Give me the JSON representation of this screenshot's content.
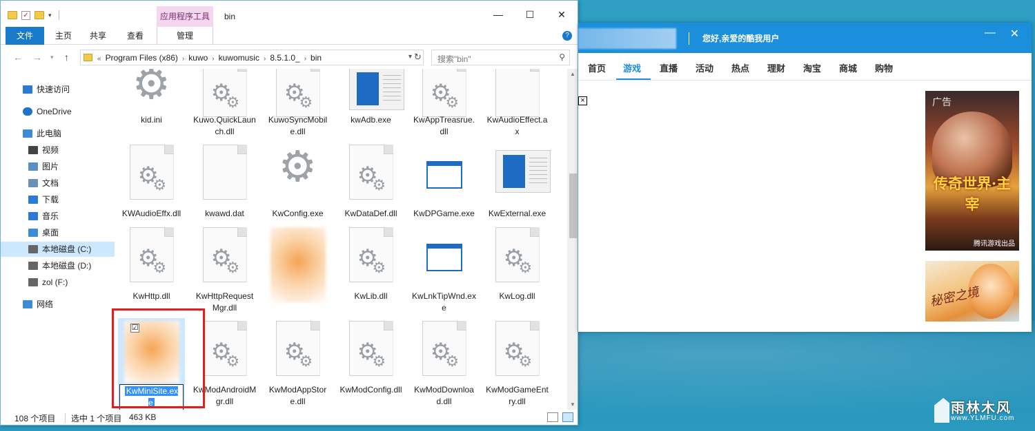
{
  "explorer": {
    "context_tab": "应用程序工具",
    "title": "bin",
    "win_controls": {
      "minimize": "—",
      "maximize": "☐",
      "close": "✕"
    },
    "ribbon": {
      "file": "文件",
      "home": "主页",
      "share": "共享",
      "view": "查看",
      "manage": "管理",
      "help": "?"
    },
    "address": {
      "crumbs": [
        "Program Files (x86)",
        "kuwo",
        "kuwomusic",
        "8.5.1.0_",
        "bin"
      ],
      "search_placeholder": "搜索\"bin\""
    },
    "nav": [
      {
        "label": "快速访问",
        "icon": "star-icon"
      },
      {
        "label": "OneDrive",
        "icon": "cloud-icon"
      },
      {
        "label": "此电脑",
        "icon": "computer-icon"
      },
      {
        "label": "视频",
        "icon": "video-icon"
      },
      {
        "label": "图片",
        "icon": "picture-icon"
      },
      {
        "label": "文档",
        "icon": "document-icon"
      },
      {
        "label": "下载",
        "icon": "download-icon"
      },
      {
        "label": "音乐",
        "icon": "music-icon"
      },
      {
        "label": "桌面",
        "icon": "desktop-icon"
      },
      {
        "label": "本地磁盘 (C:)",
        "icon": "drive-icon"
      },
      {
        "label": "本地磁盘 (D:)",
        "icon": "drive-icon"
      },
      {
        "label": "zol (F:)",
        "icon": "drive-icon"
      },
      {
        "label": "网络",
        "icon": "network-icon"
      }
    ],
    "files": [
      {
        "name": "kid.ini",
        "icon": "settings-gear-icon"
      },
      {
        "name": "Kuwo.QuickLaunch.dll",
        "icon": "dll-file-icon"
      },
      {
        "name": "KuwoSyncMobile.dll",
        "icon": "dll-file-icon"
      },
      {
        "name": "kwAdb.exe",
        "icon": "app-window-icon"
      },
      {
        "name": "KwAppTreasrue.dll",
        "icon": "dll-file-icon"
      },
      {
        "name": "KwAudioEffect.ax",
        "icon": "blank-file-icon"
      },
      {
        "name": "KWAudioEffx.dll",
        "icon": "dll-file-icon"
      },
      {
        "name": "kwawd.dat",
        "icon": "blank-file-icon"
      },
      {
        "name": "KwConfig.exe",
        "icon": "settings-gear-icon"
      },
      {
        "name": "KwDataDef.dll",
        "icon": "dll-file-icon"
      },
      {
        "name": "KwDPGame.exe",
        "icon": "exe-window-icon"
      },
      {
        "name": "KwExternal.exe",
        "icon": "app-window-icon"
      },
      {
        "name": "KwHttp.dll",
        "icon": "dll-file-icon"
      },
      {
        "name": "KwHttpRequestMgr.dll",
        "icon": "dll-file-icon"
      },
      {
        "name": "",
        "icon": "blurred-icon"
      },
      {
        "name": "KwLib.dll",
        "icon": "dll-file-icon"
      },
      {
        "name": "KwLnkTipWnd.exe",
        "icon": "exe-window-icon"
      },
      {
        "name": "KwLog.dll",
        "icon": "dll-file-icon"
      },
      {
        "name": "KwMiniSite.exe",
        "icon": "blurred-icon"
      },
      {
        "name": "KwModAndroidMgr.dll",
        "icon": "dll-file-icon"
      },
      {
        "name": "KwModAppStore.dll",
        "icon": "dll-file-icon"
      },
      {
        "name": "KwModConfig.dll",
        "icon": "dll-file-icon"
      },
      {
        "name": "KwModDownload.dll",
        "icon": "dll-file-icon"
      },
      {
        "name": "KwModGameEntry.dll",
        "icon": "dll-file-icon"
      }
    ],
    "selection_checkbox": "☑",
    "status": {
      "count": "108 个项目",
      "selected": "选中 1 个项目",
      "size": "463 KB"
    }
  },
  "kuwo": {
    "greeting": "您好,亲爱的酷我用户",
    "nav": [
      "首页",
      "游戏",
      "直播",
      "活动",
      "热点",
      "理财",
      "淘宝",
      "商城",
      "购物"
    ],
    "active_nav": "游戏",
    "close_x": "×",
    "ad1": {
      "tag": "广告",
      "title": "传奇世界·主宰",
      "footer": "腾讯游戏出品"
    },
    "ad2": {
      "script": "秘密之境"
    }
  },
  "watermark": {
    "name": "雨林木风",
    "url": "www.YLMFU.com"
  },
  "colors": {
    "accent": "#1979ca",
    "kuwo_blue": "#1c8fdc",
    "selection": "#cce8ff",
    "highlight_frame": "#e01e1e"
  }
}
